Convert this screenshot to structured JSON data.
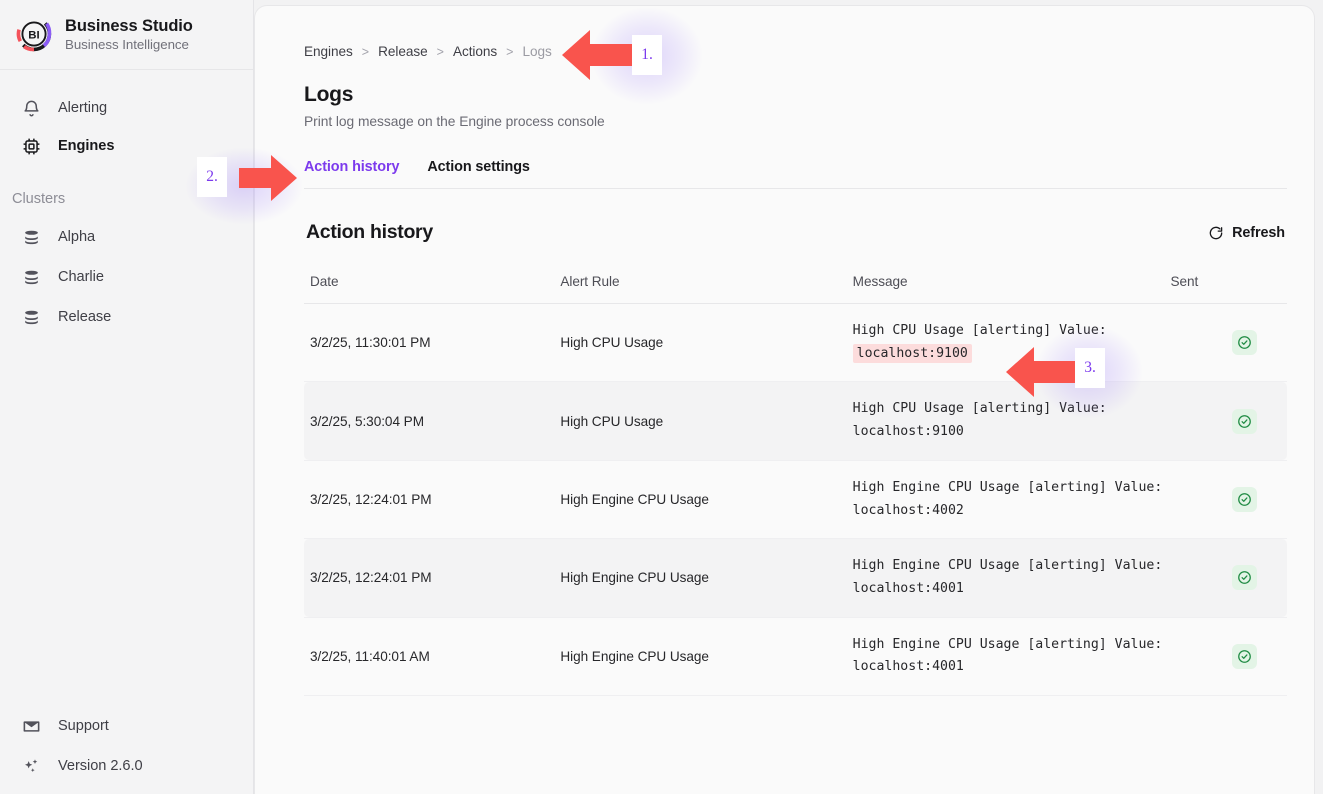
{
  "brand": {
    "logo_text": "BI",
    "title": "Business Studio",
    "subtitle": "Business Intelligence",
    "colors": {
      "ring_dark": "#18181b",
      "ring_purple": "#8b5cf6",
      "ring_red": "#f4525a"
    }
  },
  "sidebar": {
    "nav": [
      {
        "label": "Alerting",
        "icon": "bell-icon",
        "active": false
      },
      {
        "label": "Engines",
        "icon": "chip-icon",
        "active": true
      }
    ],
    "clusters_heading": "Clusters",
    "clusters": [
      {
        "label": "Alpha",
        "icon": "server-stack-icon"
      },
      {
        "label": "Charlie",
        "icon": "server-stack-icon"
      },
      {
        "label": "Release",
        "icon": "server-stack-icon"
      }
    ],
    "bottom": [
      {
        "label": "Support",
        "icon": "envelope-icon"
      },
      {
        "label": "Version 2.6.0",
        "icon": "sparkles-icon"
      }
    ]
  },
  "breadcrumb": {
    "items": [
      "Engines",
      "Release",
      "Actions",
      "Logs"
    ],
    "separator": ">"
  },
  "page": {
    "title": "Logs",
    "subtitle": "Print log message on the Engine process console"
  },
  "tabs": [
    {
      "label": "Action history",
      "active": true
    },
    {
      "label": "Action settings",
      "active": false
    }
  ],
  "panel": {
    "title": "Action history",
    "refresh_label": "Refresh",
    "refresh_icon": "refresh-icon"
  },
  "table": {
    "columns": [
      "Date",
      "Alert Rule",
      "Message",
      "Sent"
    ],
    "rows": [
      {
        "date": "3/2/25, 11:30:01 PM",
        "rule": "High CPU Usage",
        "message_pre": "High CPU Usage [alerting] Value: ",
        "message_highlight": "localhost:9100",
        "message_post": "",
        "sent": true,
        "sent_icon": "check-circle-icon",
        "alt": false
      },
      {
        "date": "3/2/25, 5:30:04 PM",
        "rule": "High CPU Usage",
        "message_pre": "High CPU Usage [alerting] Value: localhost:9100",
        "message_highlight": "",
        "message_post": "",
        "sent": true,
        "sent_icon": "check-circle-icon",
        "alt": true
      },
      {
        "date": "3/2/25, 12:24:01 PM",
        "rule": "High Engine CPU Usage",
        "message_pre": "High Engine CPU Usage [alerting] Value: localhost:4002",
        "message_highlight": "",
        "message_post": "",
        "sent": true,
        "sent_icon": "check-circle-icon",
        "alt": false
      },
      {
        "date": "3/2/25, 12:24:01 PM",
        "rule": "High Engine CPU Usage",
        "message_pre": "High Engine CPU Usage [alerting] Value: localhost:4001",
        "message_highlight": "",
        "message_post": "",
        "sent": true,
        "sent_icon": "check-circle-icon",
        "alt": true
      },
      {
        "date": "3/2/25, 11:40:01 AM",
        "rule": "High Engine CPU Usage",
        "message_pre": "High Engine CPU Usage [alerting] Value: localhost:4001",
        "message_highlight": "",
        "message_post": "",
        "sent": true,
        "sent_icon": "check-circle-icon",
        "alt": false
      }
    ]
  },
  "annotations": {
    "arrow_color": "#f9544d",
    "number_color": "#7c3aed",
    "items": [
      {
        "number": "1.",
        "direction": "left"
      },
      {
        "number": "2.",
        "direction": "right"
      },
      {
        "number": "3.",
        "direction": "left"
      }
    ]
  }
}
